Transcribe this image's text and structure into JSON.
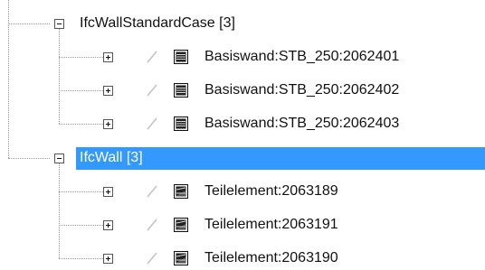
{
  "tree": {
    "groups": [
      {
        "label": "IfcWallStandardCase [3]",
        "expanded": true,
        "selected": false,
        "children": [
          {
            "label": "Basiswand:STB_250:2062401",
            "icon": "wall-standard-icon"
          },
          {
            "label": "Basiswand:STB_250:2062402",
            "icon": "wall-standard-icon"
          },
          {
            "label": "Basiswand:STB_250:2062403",
            "icon": "wall-standard-icon"
          }
        ]
      },
      {
        "label": "IfcWall [3]",
        "expanded": true,
        "selected": true,
        "children": [
          {
            "label": "Teilelement:2063189",
            "icon": "wall-part-icon"
          },
          {
            "label": "Teilelement:2063191",
            "icon": "wall-part-icon"
          },
          {
            "label": "Teilelement:2063190",
            "icon": "wall-part-icon"
          }
        ]
      }
    ]
  },
  "colors": {
    "selection": "#3399ff",
    "selection_text": "#ffffff"
  }
}
